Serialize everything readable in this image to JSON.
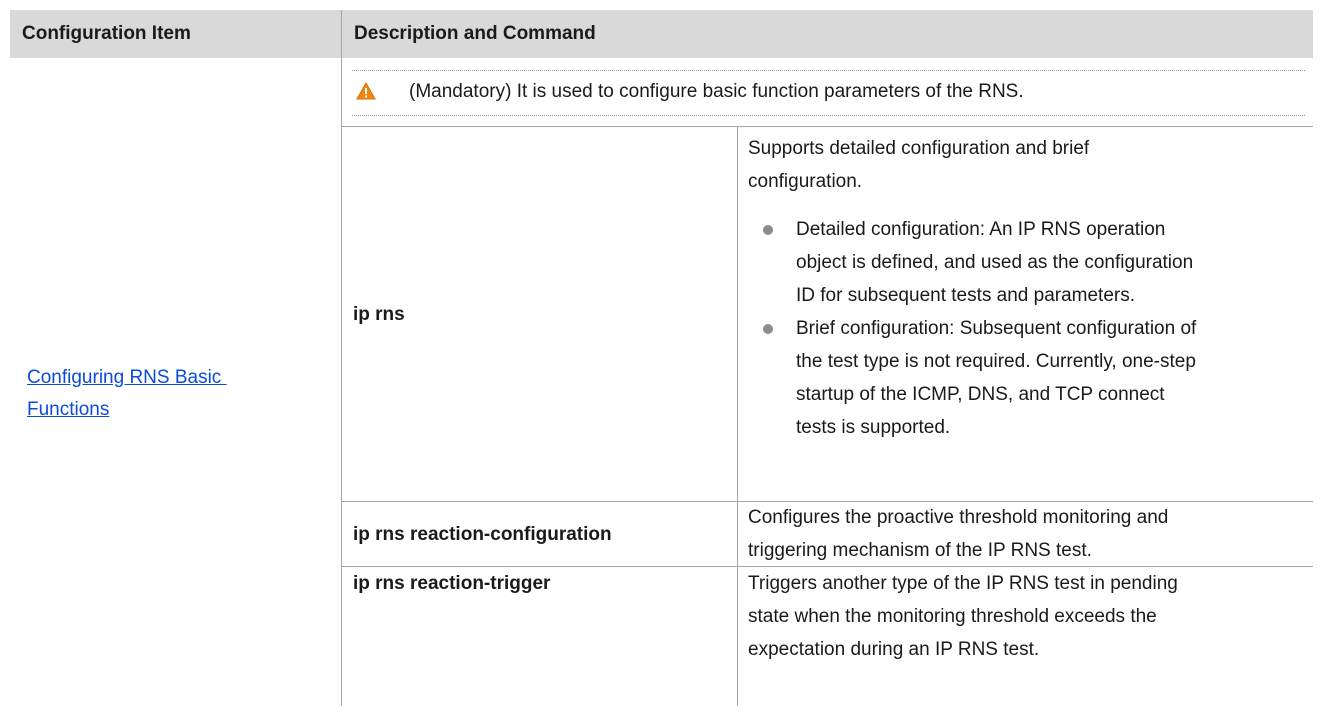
{
  "table": {
    "header": {
      "col1": "Configuration Item",
      "col2": "Description and Command"
    },
    "item_link": [
      "Configuring RNS Basic ",
      "Functions"
    ],
    "note_text": "(Mandatory) It is used to configure basic function parameters of the RNS.",
    "note_icon": "warning-icon",
    "rows": [
      {
        "command": "ip rns",
        "description": [
          "Supports detailed configuration and brief",
          "configuration."
        ],
        "bullets": [
          [
            "Detailed configuration: An IP RNS operation",
            "object is defined, and used as the configuration",
            "ID for subsequent tests and parameters."
          ],
          [
            "Brief configuration: Subsequent configuration of",
            "the test type is not required. Currently, one-step",
            "startup of the ICMP, DNS, and TCP connect",
            "tests is supported."
          ]
        ]
      },
      {
        "command": "ip rns reaction-configuration",
        "description": [
          "Configures the proactive threshold monitoring and",
          "triggering mechanism of the IP RNS test."
        ]
      },
      {
        "command": "ip rns reaction-trigger",
        "description": [
          "Triggers another type of the IP RNS test in pending",
          "state when the monitoring threshold exceeds the",
          "expectation during an IP RNS test."
        ]
      }
    ]
  },
  "colors": {
    "header_bg": "#d9d9d9",
    "border": "#a6a6a6",
    "link": "#0b4bd8",
    "warning": "#f0890e"
  }
}
